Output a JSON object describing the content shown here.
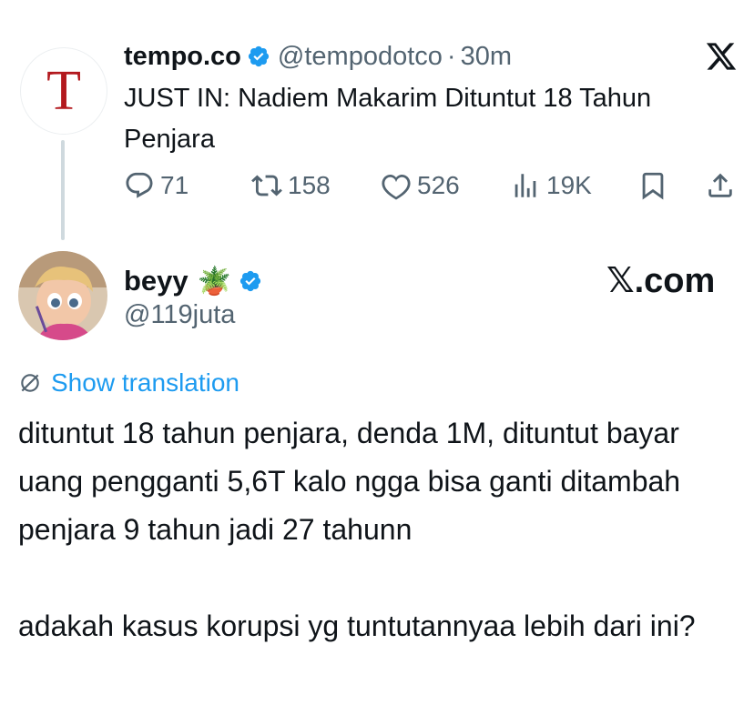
{
  "quoted_tweet": {
    "avatar_letter": "T",
    "display_name": "tempo.co",
    "handle": "@tempodotco",
    "separator": "·",
    "time": "30m",
    "text": "JUST IN: Nadiem Makarim Dituntut 18 Tahun Penjara",
    "actions": {
      "replies": "71",
      "reposts": "158",
      "likes": "526",
      "views": "19K"
    }
  },
  "main_tweet": {
    "display_name": "beyy",
    "name_emoji": "🪴",
    "handle": "@119juta",
    "show_translation_label": "Show translation",
    "text": "dituntut 18 tahun penjara, denda 1M, dituntut bayar uang pengganti 5,6T kalo ngga bisa ganti ditambah penjara 9 tahun jadi 27 tahunn\n\nadakah kasus korupsi yg tuntutannyaa lebih dari ini?"
  },
  "watermark": "𝕏.com",
  "colors": {
    "accent_blue": "#1d9bf0",
    "secondary_text": "#536471",
    "primary_text": "#0f1419",
    "tempo_red": "#b3191e"
  },
  "icons": [
    "verified-badge-icon",
    "x-logo-icon",
    "reply-icon",
    "repost-icon",
    "like-icon",
    "views-icon",
    "bookmark-icon",
    "share-icon",
    "translate-icon"
  ]
}
